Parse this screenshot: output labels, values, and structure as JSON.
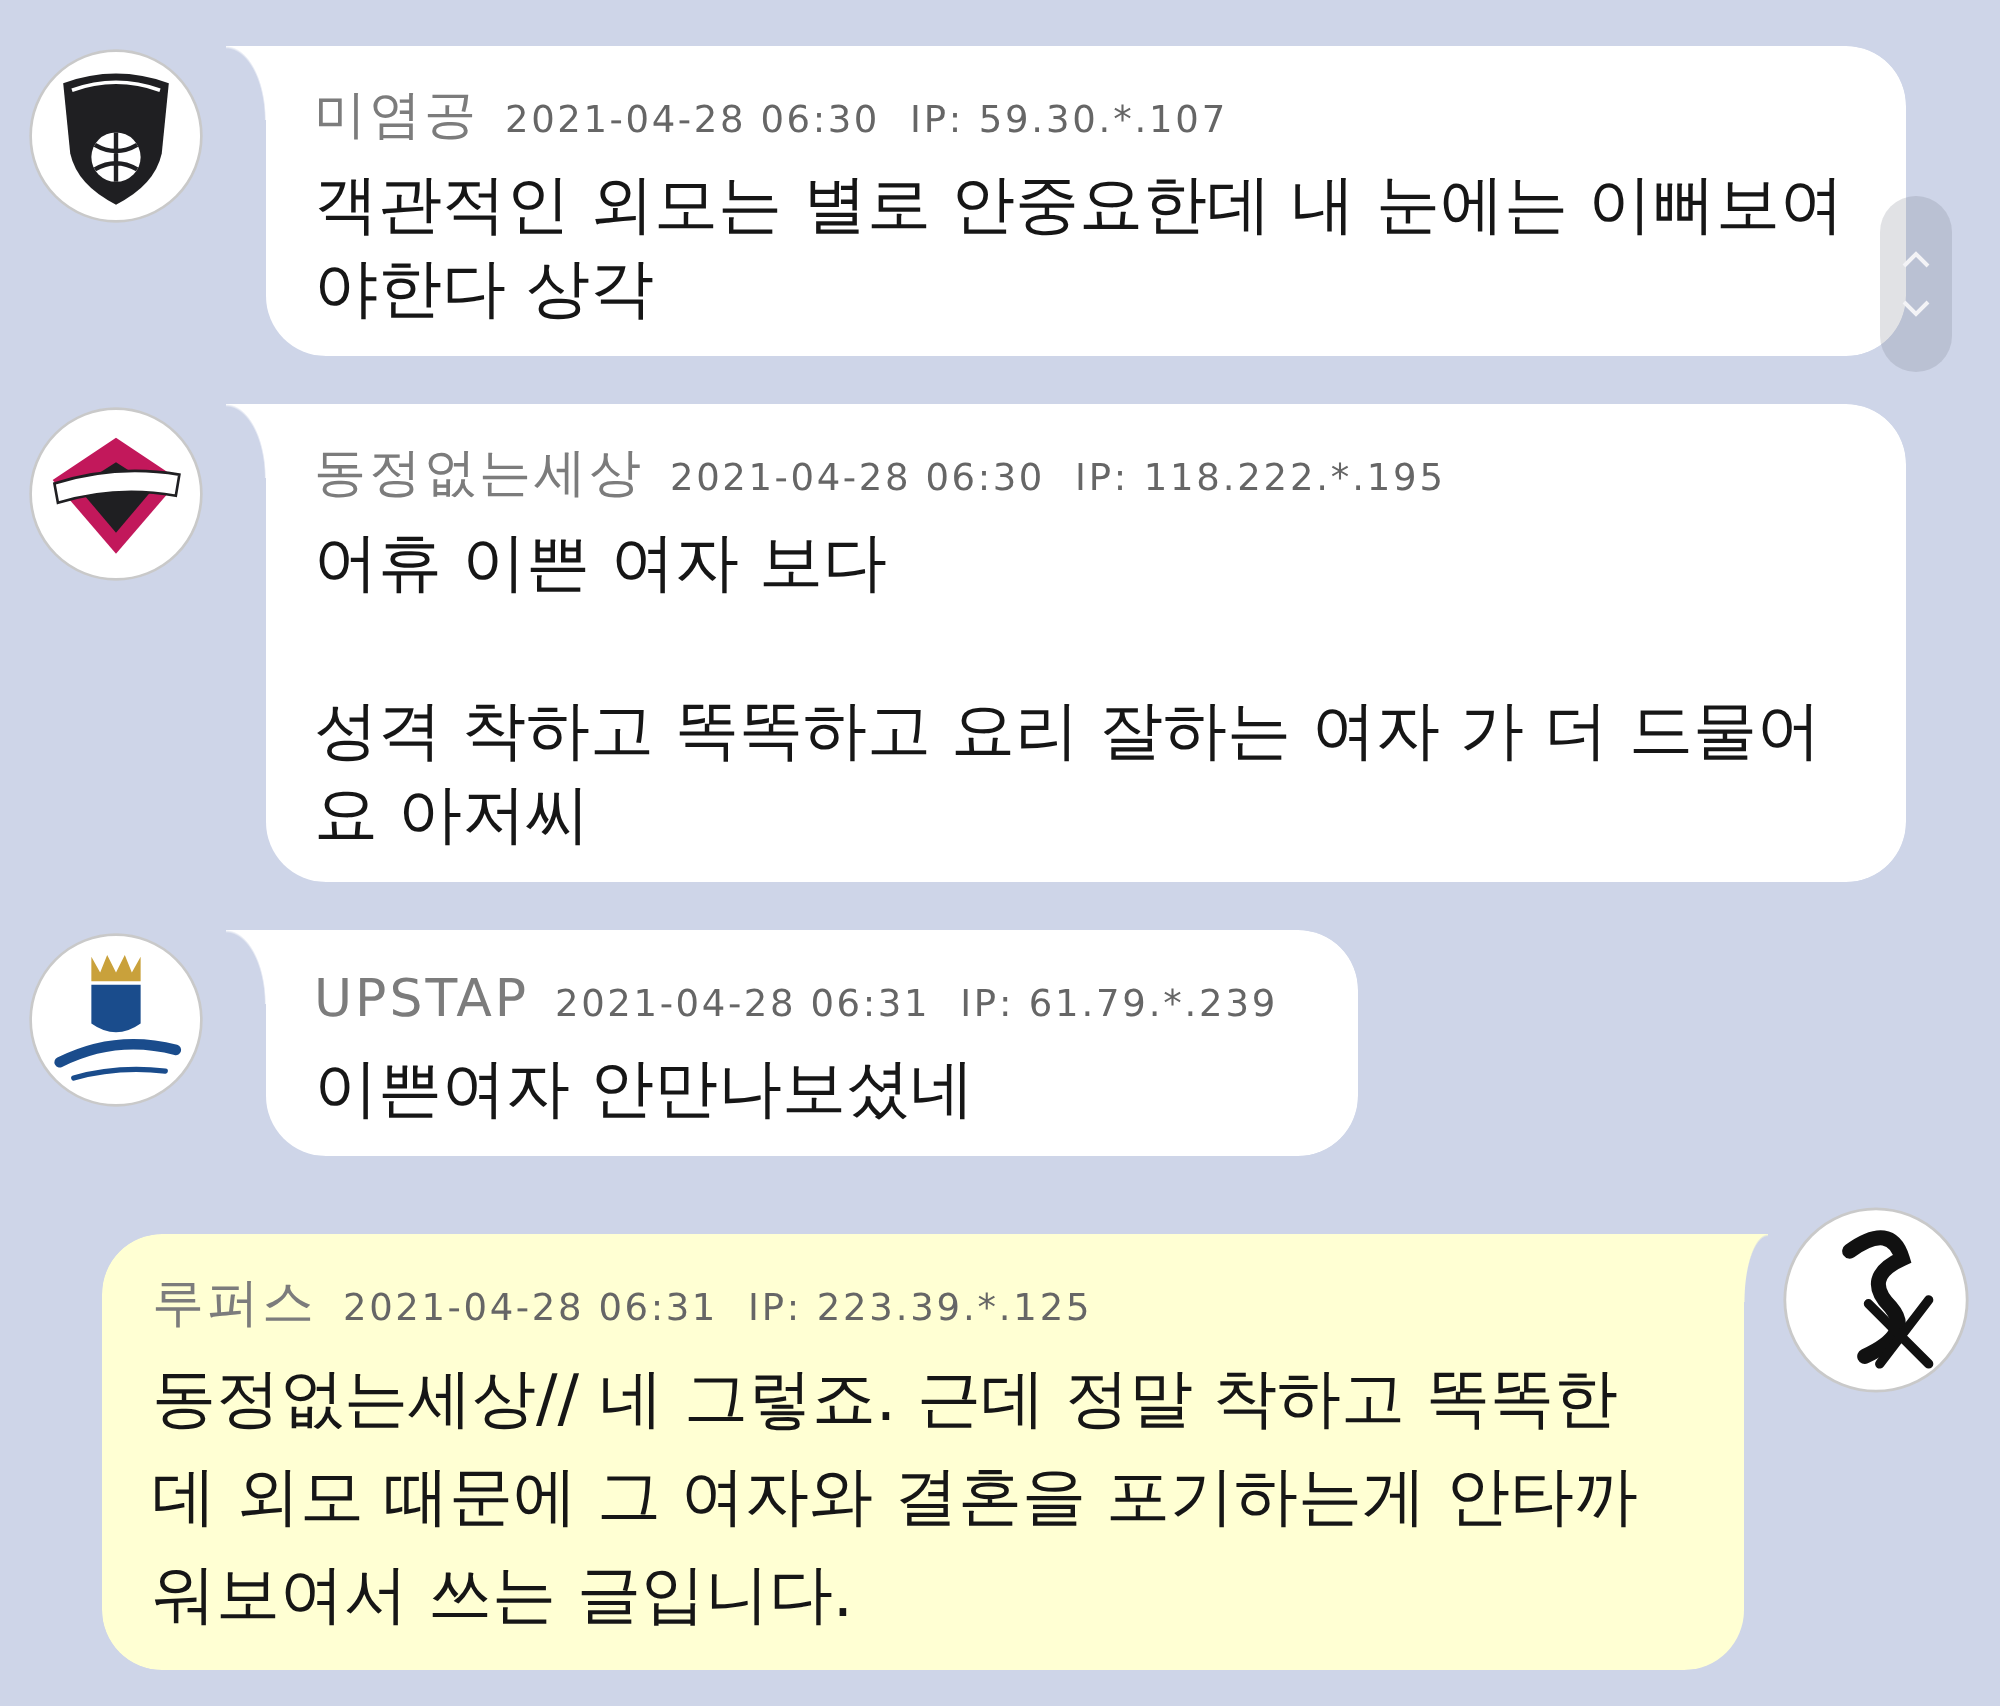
{
  "comments": [
    {
      "own": false,
      "author": "미염공",
      "date": "2021-04-28 06:30",
      "ip": "IP: 59.30.*.107",
      "text": "객관적인 외모는 별로 안중요한데 내 눈에는 이뻐보여야한다 상각"
    },
    {
      "own": false,
      "author": "동정없는세상",
      "date": "2021-04-28 06:30",
      "ip": "IP: 118.222.*.195",
      "text": "어휴 이쁜 여자 보다\n\n성격 착하고 똑똑하고 요리 잘하는 여자 가 더 드물어요 아저씨"
    },
    {
      "own": false,
      "author": "UPSTAP",
      "date": "2021-04-28 06:31",
      "ip": "IP: 61.79.*.239",
      "text": "이쁜여자 안만나보셨네"
    },
    {
      "own": true,
      "author": "루퍼스",
      "date": "2021-04-28 06:31",
      "ip": "IP: 223.39.*.125",
      "text": "동정없는세상// 네 그렇죠. 근데 정말 착하고 똑똑한데 외모 때문에 그 여자와 결혼을 포기하는게 안타까워보여서 쓰는 글입니다."
    }
  ]
}
